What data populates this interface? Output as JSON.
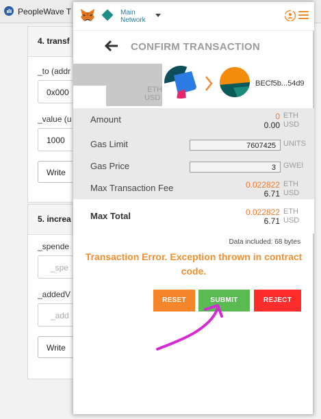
{
  "browser": {
    "tab_title": "PeopleWave T"
  },
  "background_page": {
    "card4": {
      "title": "4. transf",
      "to_label": "_to (addr",
      "to_value": "0x000",
      "value_label": "_value (u",
      "value_value": "1000",
      "write_label": "Write"
    },
    "card5": {
      "title": "5. increa",
      "spender_label": "_spende",
      "spender_placeholder": "_spe",
      "added_label": "_addedV",
      "added_placeholder": "_add",
      "write_label": "Write"
    }
  },
  "metamask": {
    "network": {
      "line1": "Main",
      "line2": "Network"
    },
    "title": "CONFIRM TRANSACTION",
    "from": {
      "eth_unit": "ETH",
      "usd_unit": "USD"
    },
    "to": {
      "address": "BECf5b...54d9"
    },
    "amount": {
      "label": "Amount",
      "eth_value": "0",
      "eth_unit": "ETH",
      "usd_value": "0.00",
      "usd_unit": "USD"
    },
    "gas_limit": {
      "label": "Gas Limit",
      "value": "7607425",
      "unit": "UNITS"
    },
    "gas_price": {
      "label": "Gas Price",
      "value": "3",
      "unit": "GWEI"
    },
    "max_fee": {
      "label": "Max Transaction Fee",
      "eth_value": "0.022822",
      "eth_unit": "ETH",
      "usd_value": "6.71",
      "usd_unit": "USD"
    },
    "max_total": {
      "label": "Max Total",
      "eth_value": "0.022822",
      "eth_unit": "ETH",
      "usd_value": "6.71",
      "usd_unit": "USD"
    },
    "data_included": "Data included: 68 bytes",
    "error": "Transaction Error. Exception thrown in contract code.",
    "buttons": {
      "reset": "RESET",
      "submit": "SUBMIT",
      "reject": "REJECT"
    }
  },
  "colors": {
    "metamask_orange": "#f0782e",
    "submit_green": "#5abb53",
    "reject_red": "#ff2c2c",
    "reset_orange": "#f4852b",
    "annotation_magenta": "#d42bd4"
  }
}
